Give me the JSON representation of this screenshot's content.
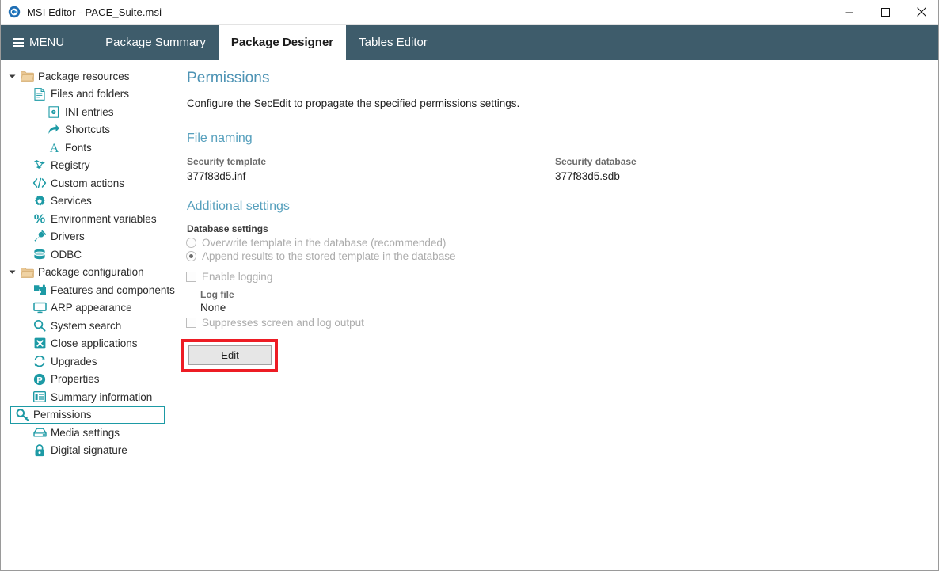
{
  "window": {
    "title": "MSI Editor - PACE_Suite.msi",
    "app_icon": "pace-suite-logo-icon",
    "controls": [
      {
        "name": "minimize-button",
        "glyph": "minimize-icon"
      },
      {
        "name": "maximize-button",
        "glyph": "maximize-icon"
      },
      {
        "name": "close-button",
        "glyph": "close-icon"
      }
    ]
  },
  "header": {
    "menu_label": "MENU",
    "menu_icon": "hamburger-icon",
    "accent_color": "#3e5c6b",
    "tabs": [
      {
        "label": "Package Summary",
        "active": false
      },
      {
        "label": "Package Designer",
        "active": true
      },
      {
        "label": "Tables Editor",
        "active": false
      }
    ]
  },
  "sidebar": {
    "groups": [
      {
        "label": "Package resources",
        "icon": "folder-open-icon",
        "expanded": true,
        "items": [
          {
            "label": "Files and folders",
            "icon": "document-icon",
            "level": 1,
            "selected": false
          },
          {
            "label": "INI entries",
            "icon": "ini-file-icon",
            "level": 2,
            "selected": false
          },
          {
            "label": "Shortcuts",
            "icon": "shortcut-arrow-icon",
            "level": 2,
            "selected": false
          },
          {
            "label": "Fonts",
            "icon": "font-a-icon",
            "level": 2,
            "selected": false
          },
          {
            "label": "Registry",
            "icon": "registry-blocks-icon",
            "level": 1,
            "selected": false
          },
          {
            "label": "Custom actions",
            "icon": "code-brackets-icon",
            "level": 1,
            "selected": false
          },
          {
            "label": "Services",
            "icon": "gear-icon",
            "level": 1,
            "selected": false
          },
          {
            "label": "Environment variables",
            "icon": "percent-icon",
            "level": 1,
            "selected": false
          },
          {
            "label": "Drivers",
            "icon": "plug-icon",
            "level": 1,
            "selected": false
          },
          {
            "label": "ODBC",
            "icon": "database-icon",
            "level": 1,
            "selected": false
          }
        ]
      },
      {
        "label": "Package configuration",
        "icon": "folder-open-icon",
        "expanded": true,
        "items": [
          {
            "label": "Features and components",
            "icon": "puzzle-piece-icon",
            "level": 1,
            "selected": false
          },
          {
            "label": "ARP appearance",
            "icon": "monitor-icon",
            "level": 1,
            "selected": false
          },
          {
            "label": "System search",
            "icon": "magnifier-icon",
            "level": 1,
            "selected": false
          },
          {
            "label": "Close applications",
            "icon": "x-square-icon",
            "level": 1,
            "selected": false
          },
          {
            "label": "Upgrades",
            "icon": "refresh-arrows-icon",
            "level": 1,
            "selected": false
          },
          {
            "label": "Properties",
            "icon": "p-circle-icon",
            "level": 1,
            "selected": false
          },
          {
            "label": "Summary information",
            "icon": "list-panel-icon",
            "level": 1,
            "selected": false
          },
          {
            "label": "Permissions",
            "icon": "key-magnifier-icon",
            "level": 1,
            "selected": true
          },
          {
            "label": "Media settings",
            "icon": "media-drive-icon",
            "level": 1,
            "selected": false
          },
          {
            "label": "Digital signature",
            "icon": "lock-icon",
            "level": 1,
            "selected": false
          }
        ]
      }
    ],
    "selection_border_color": "#1d9aa5",
    "icon_color": "#1d9aa5",
    "folder_color": "#e5c08a"
  },
  "main": {
    "title": "Permissions",
    "description": "Configure the SecEdit to propagate the specified permissions settings.",
    "section_file_naming": {
      "heading": "File naming",
      "security_template_label": "Security template",
      "security_template_value": "377f83d5.inf",
      "security_database_label": "Security database",
      "security_database_value": "377f83d5.sdb"
    },
    "section_additional": {
      "heading": "Additional settings",
      "database_settings_label": "Database settings",
      "radios": [
        {
          "label": "Overwrite template in the database (recommended)",
          "checked": false
        },
        {
          "label": "Append results to the stored template in the database",
          "checked": true
        }
      ],
      "enable_logging": {
        "label": "Enable logging",
        "checked": false
      },
      "log_file_label": "Log file",
      "log_file_value": "None",
      "suppress_output": {
        "label": "Suppresses screen and log output",
        "checked": false
      }
    },
    "edit_button": {
      "label": "Edit",
      "highlight_color": "#ed1c24"
    },
    "heading_color": "#57a0bd"
  }
}
